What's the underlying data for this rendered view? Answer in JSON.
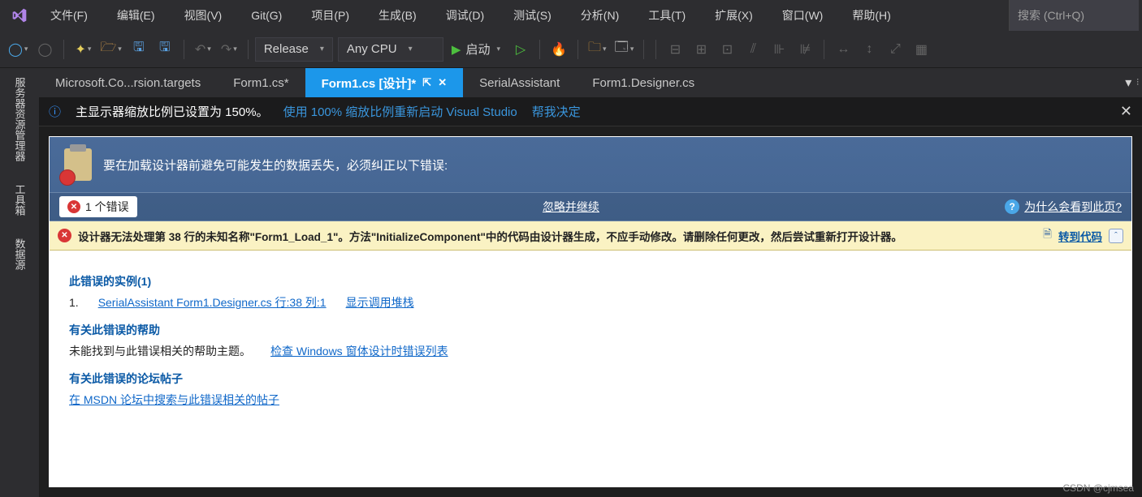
{
  "menu": {
    "file": "文件(F)",
    "edit": "编辑(E)",
    "view": "视图(V)",
    "git": "Git(G)",
    "project": "项目(P)",
    "build": "生成(B)",
    "debug": "调试(D)",
    "test": "测试(S)",
    "analyze": "分析(N)",
    "tools": "工具(T)",
    "extensions": "扩展(X)",
    "window": "窗口(W)",
    "help": "帮助(H)"
  },
  "search_placeholder": "搜索 (Ctrl+Q)",
  "toolbar": {
    "config": "Release",
    "platform": "Any CPU",
    "start": "启动"
  },
  "rail": {
    "server": "服务器资源管理器",
    "toolbox": "工具箱",
    "datasource": "数据源"
  },
  "tabs": [
    {
      "label": "Microsoft.Co...rsion.targets",
      "active": false
    },
    {
      "label": "Form1.cs*",
      "active": false
    },
    {
      "label": "Form1.cs [设计]*",
      "active": true
    },
    {
      "label": "SerialAssistant",
      "active": false
    },
    {
      "label": "Form1.Designer.cs",
      "active": false
    }
  ],
  "infobar": {
    "text": "主显示器缩放比例已设置为 150%。",
    "action1": "使用 100% 缩放比例重新启动 Visual Studio",
    "action2": "帮我决定"
  },
  "designer": {
    "headline": "要在加载设计器前避免可能发生的数据丢失，必须纠正以下错误:",
    "error_count": "1 个错误",
    "ignore": "忽略并继续",
    "why": "为什么会看到此页?",
    "yellow_msg": "设计器无法处理第 38 行的未知名称\"Form1_Load_1\"。方法\"InitializeComponent\"中的代码由设计器生成，不应手动修改。请删除任何更改，然后尝试重新打开设计器。",
    "goto_code": "转到代码",
    "section1": "此错误的实例(1)",
    "instance_num": "1.",
    "instance": "SerialAssistant Form1.Designer.cs 行:38 列:1",
    "callstack": "显示调用堆栈",
    "section2": "有关此错误的帮助",
    "help_text": "未能找到与此错误相关的帮助主题。",
    "help_link": "检查 Windows 窗体设计时错误列表",
    "section3": "有关此错误的论坛帖子",
    "forum_link": "在 MSDN 论坛中搜索与此错误相关的帖子"
  },
  "watermark": "CSDN @cjmsea"
}
